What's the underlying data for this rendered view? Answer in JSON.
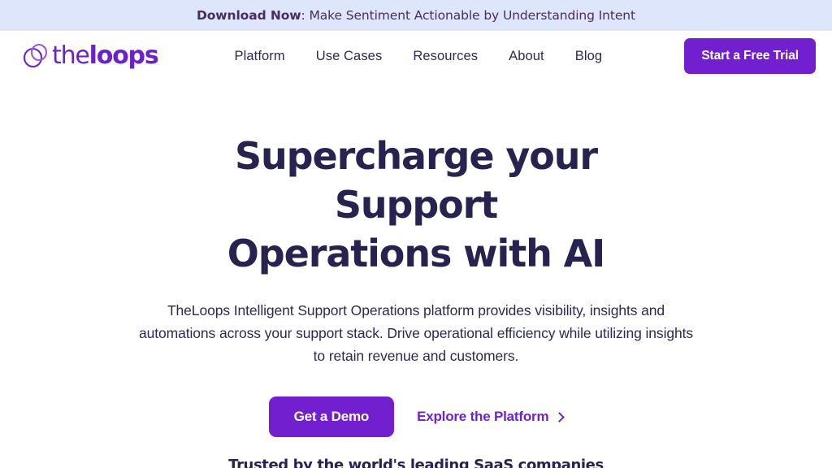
{
  "announcement": {
    "strong_label": "Download Now",
    "rest_label": ": Make Sentiment Actionable by Understanding Intent",
    "background_color": "#dee6fb",
    "text_color": "#4b2c60"
  },
  "header": {
    "brand": {
      "word_the": "the",
      "word_loops": "loops",
      "icon": "overlapping-loops-icon",
      "color": "#6d22c9"
    },
    "nav": [
      {
        "label": "Platform"
      },
      {
        "label": "Use Cases"
      },
      {
        "label": "Resources"
      },
      {
        "label": "About"
      },
      {
        "label": "Blog"
      }
    ],
    "cta_label": "Start a Free Trial",
    "cta_color": "#7220cf"
  },
  "hero": {
    "title_line_1": "Supercharge your Support",
    "title_line_2": "Operations with AI",
    "title_color": "#262350",
    "subtitle": "TheLoops Intelligent Support Operations platform provides visibility, insights and automations across your support stack. Drive operational efficiency while utilizing insights to retain revenue and customers.",
    "primary_cta_label": "Get a Demo",
    "secondary_cta_label": "Explore the Platform",
    "secondary_cta_icon": "chevron-right-icon",
    "accent_color": "#7220cf"
  },
  "social_proof": {
    "heading": "Trusted by the world's leading SaaS companies"
  }
}
